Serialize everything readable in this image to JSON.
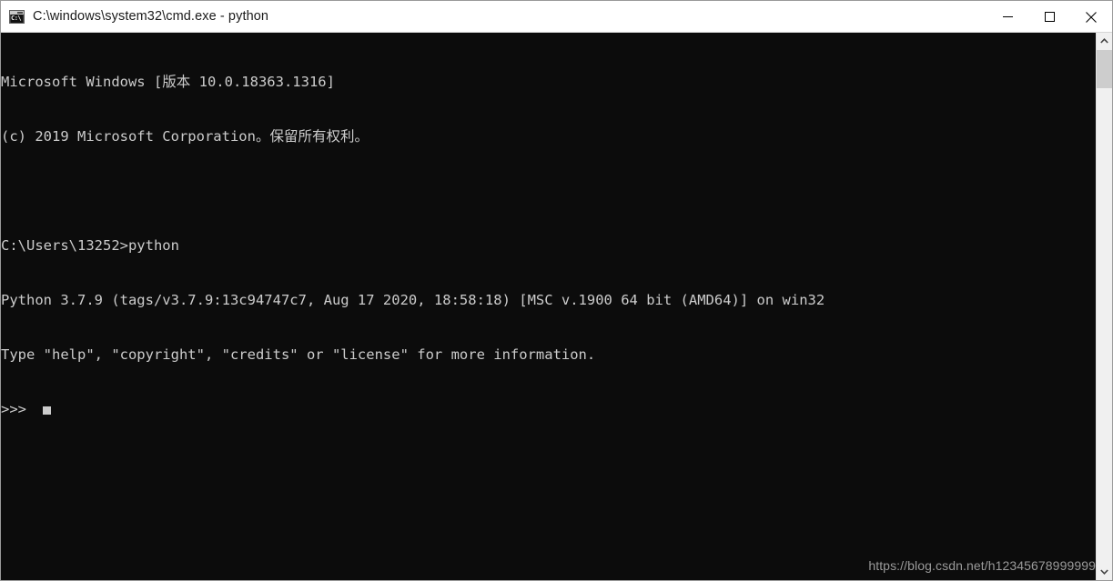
{
  "window": {
    "title": "C:\\windows\\system32\\cmd.exe - python",
    "icon": "cmd-console-icon",
    "icon_glyph": "C:\\",
    "controls": {
      "minimize": "minimize-button",
      "maximize": "maximize-button",
      "close": "close-button"
    }
  },
  "console": {
    "background_color": "#0c0c0c",
    "text_color": "#cccccc",
    "lines": [
      "Microsoft Windows [版本 10.0.18363.1316]",
      "(c) 2019 Microsoft Corporation。保留所有权利。",
      "",
      "C:\\Users\\13252>python",
      "Python 3.7.9 (tags/v3.7.9:13c94747c7, Aug 17 2020, 18:58:18) [MSC v.1900 64 bit (AMD64)] on win32",
      "Type \"help\", \"copyright\", \"credits\" or \"license\" for more information.",
      ">>>"
    ],
    "prompt": ">>>",
    "cursor": "block-cursor"
  },
  "watermark": {
    "text": "https://blog.csdn.net/h12345678999999"
  },
  "scrollbar": {
    "up_arrow": "scroll-up-arrow",
    "down_arrow": "scroll-down-arrow",
    "thumb": "scroll-thumb"
  }
}
